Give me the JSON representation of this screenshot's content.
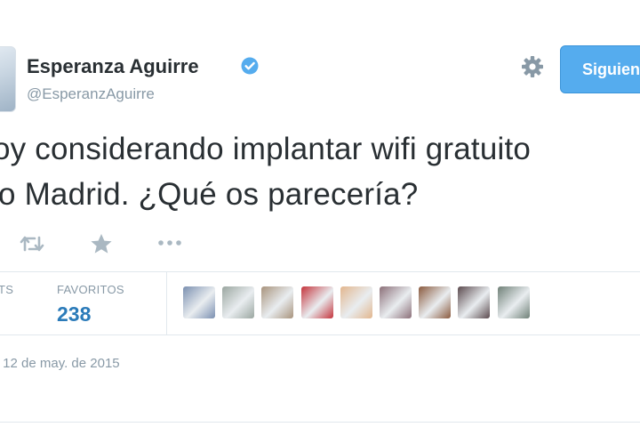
{
  "tweet": {
    "author_name": "Esperanza Aguirre",
    "author_handle": "@EsperanzAguirre",
    "follow_button_label": "Siguien",
    "text_line_1": "oy considerando implantar wifi gratuito",
    "text_line_2": "lo Madrid. ¿Qué os parecería?",
    "stats": {
      "retweets_label": "TS",
      "retweets_value": "",
      "favorites_label": "FAVORITOS",
      "favorites_value": "238"
    },
    "date": "- 12 de may. de 2015",
    "favoriter_avatars": [
      {
        "name": "avatar-1",
        "color": "#7a8fb0"
      },
      {
        "name": "avatar-2",
        "color": "#9aa6a0"
      },
      {
        "name": "avatar-3",
        "color": "#a8937c"
      },
      {
        "name": "avatar-4",
        "color": "#c4343c"
      },
      {
        "name": "avatar-5",
        "color": "#e2b68e"
      },
      {
        "name": "avatar-6",
        "color": "#8b6f78"
      },
      {
        "name": "avatar-7",
        "color": "#8a5a3e"
      },
      {
        "name": "avatar-8",
        "color": "#5b4a4e"
      },
      {
        "name": "avatar-9",
        "color": "#6f8077"
      }
    ]
  },
  "icons": {
    "verified": "verified-badge-icon",
    "settings": "gear-icon",
    "retweet": "retweet-icon",
    "favorite": "star-icon",
    "more": "more-dots-icon"
  },
  "colors": {
    "accent": "#55acee",
    "link": "#2b7bb9",
    "muted": "#8899a6",
    "text": "#292f33"
  }
}
